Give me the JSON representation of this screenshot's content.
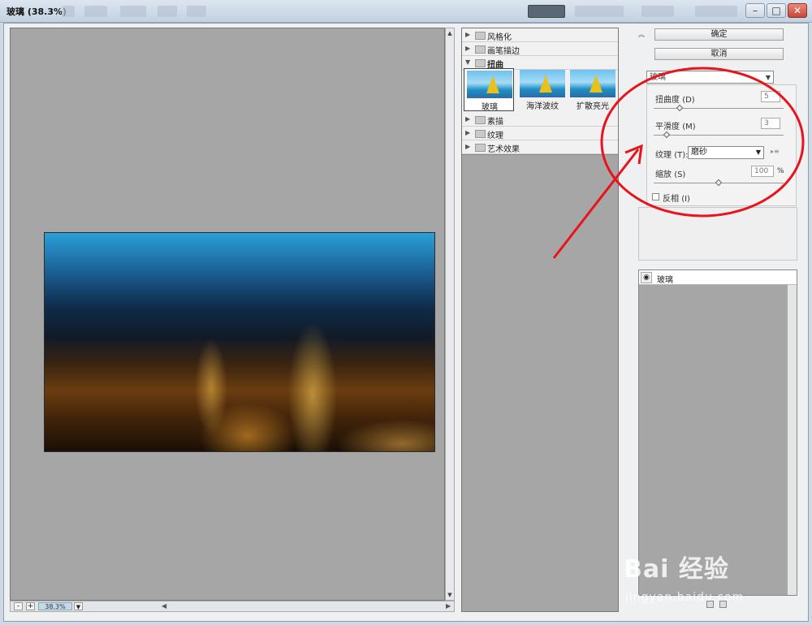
{
  "window": {
    "title": "玻璃 (38.3%)"
  },
  "preview": {
    "zoom": "38.3%"
  },
  "gallery": {
    "folders_top": [
      "风格化",
      "画笔描边"
    ],
    "open_folder": "扭曲",
    "thumbnails": [
      "玻璃",
      "海洋波纹",
      "扩散亮光"
    ],
    "folders_bottom": [
      "素描",
      "纹理",
      "艺术效果"
    ]
  },
  "panel": {
    "ok_label": "确定",
    "cancel_label": "取消",
    "filter_selected": "玻璃",
    "distortion_label": "扭曲度",
    "distortion_key": "(D)",
    "distortion_value": "5",
    "smoothness_label": "平滑度",
    "smoothness_key": "(M)",
    "smoothness_value": "3",
    "texture_label": "纹理",
    "texture_key": "(T):",
    "texture_value": "磨砂",
    "scaling_label": "缩放",
    "scaling_key": "(S)",
    "scaling_value": "100",
    "scaling_unit": "%",
    "invert_label": "反相",
    "invert_key": "(I)",
    "invert_checked": false,
    "distortion_level": 0.2,
    "smoothness_level": 0.1,
    "scaling_level": 0.5
  },
  "layers": {
    "items": [
      "玻璃"
    ]
  },
  "watermark": {
    "logo": "Bai 经验",
    "url": "jingyan.baidu.com"
  },
  "colors": {
    "annotation": "#e8141b"
  }
}
